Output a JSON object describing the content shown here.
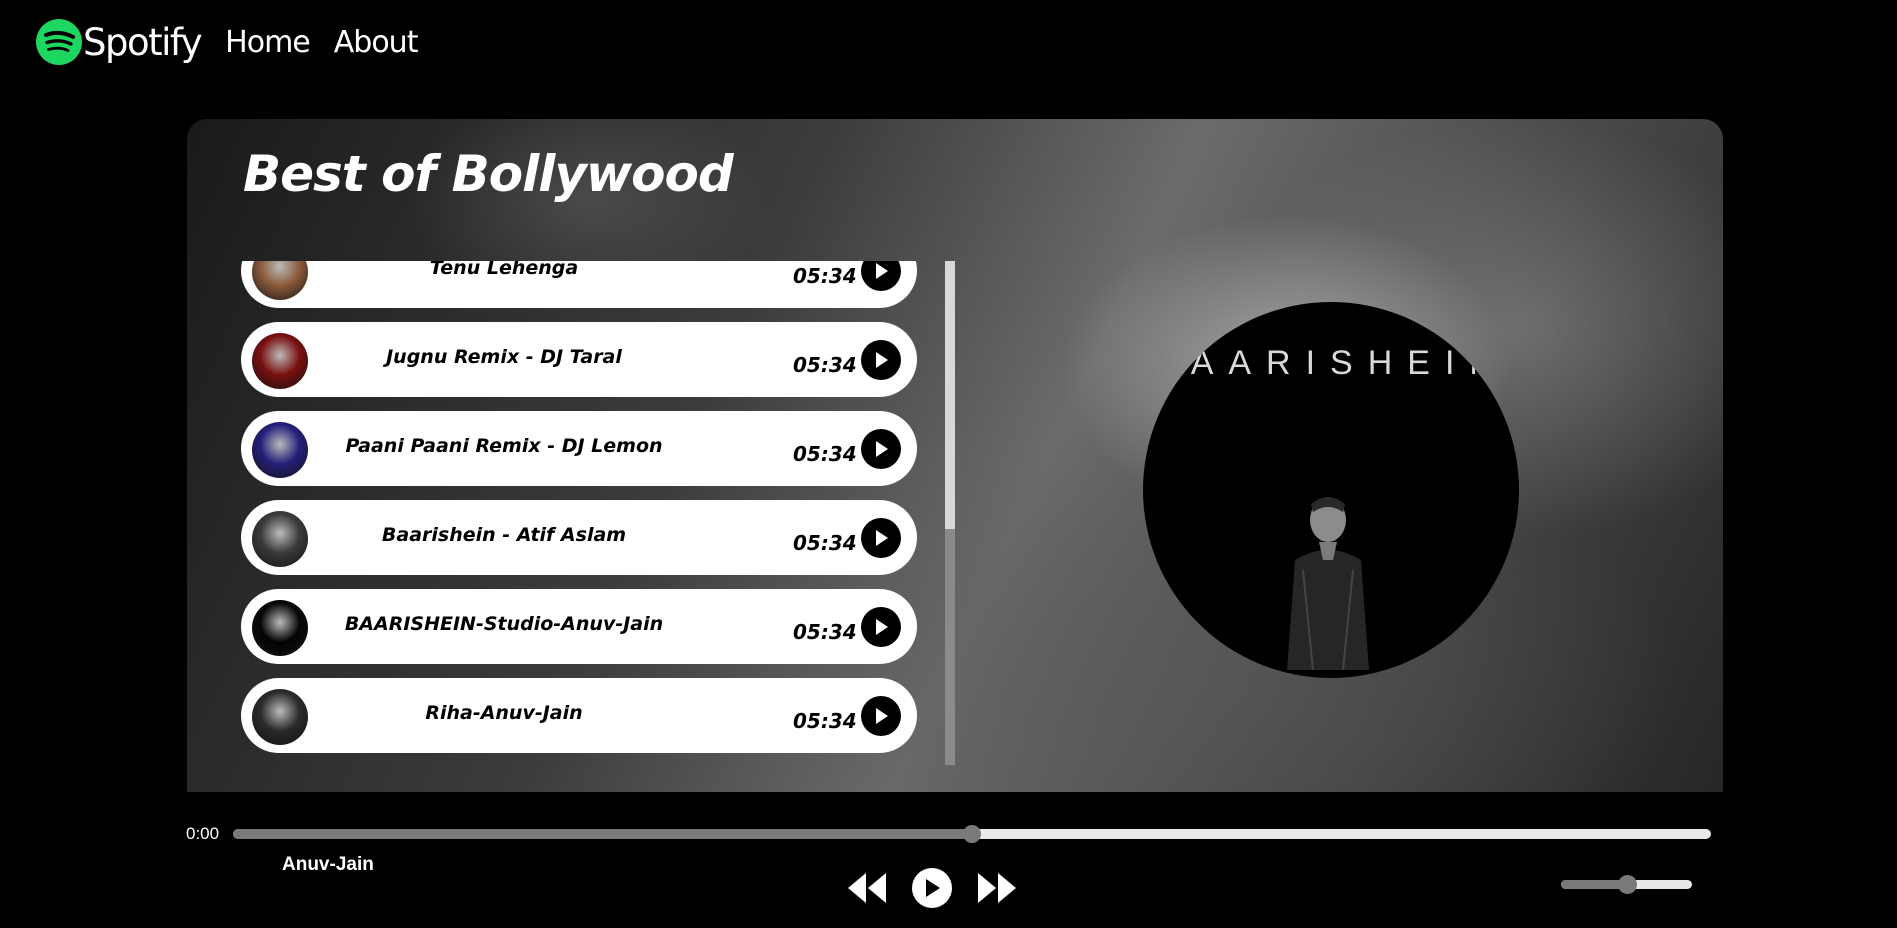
{
  "nav": {
    "brand": "Spotify",
    "links": [
      "Home",
      "About"
    ]
  },
  "playlist": {
    "title": "Best of Bollywood",
    "songs": [
      {
        "title": "Tenu Lehenga",
        "duration": "05:34",
        "thumb_color": "#8a5a3a"
      },
      {
        "title": "Jugnu Remix - DJ Taral",
        "duration": "05:34",
        "thumb_color": "#7a1010"
      },
      {
        "title": "Paani Paani Remix - DJ Lemon",
        "duration": "05:34",
        "thumb_color": "#24207a"
      },
      {
        "title": "Baarishein - Atif Aslam",
        "duration": "05:34",
        "thumb_color": "#3a3a3a"
      },
      {
        "title": "BAARISHEIN-Studio-Anuv-Jain",
        "duration": "05:34",
        "thumb_color": "#050505"
      },
      {
        "title": "Riha-Anuv-Jain",
        "duration": "05:34",
        "thumb_color": "#2a2a2a"
      }
    ]
  },
  "cover": {
    "text": "BAARISHEIN"
  },
  "player": {
    "current_time": "0:00",
    "progress": 0.5,
    "now_playing": "Anuv-Jain",
    "volume": 0.5,
    "icons": {
      "prev": "backward-icon",
      "play": "play-icon",
      "next": "forward-icon"
    }
  },
  "colors": {
    "brand_green": "#1ed760",
    "control_gray": "#7a7a7a"
  }
}
